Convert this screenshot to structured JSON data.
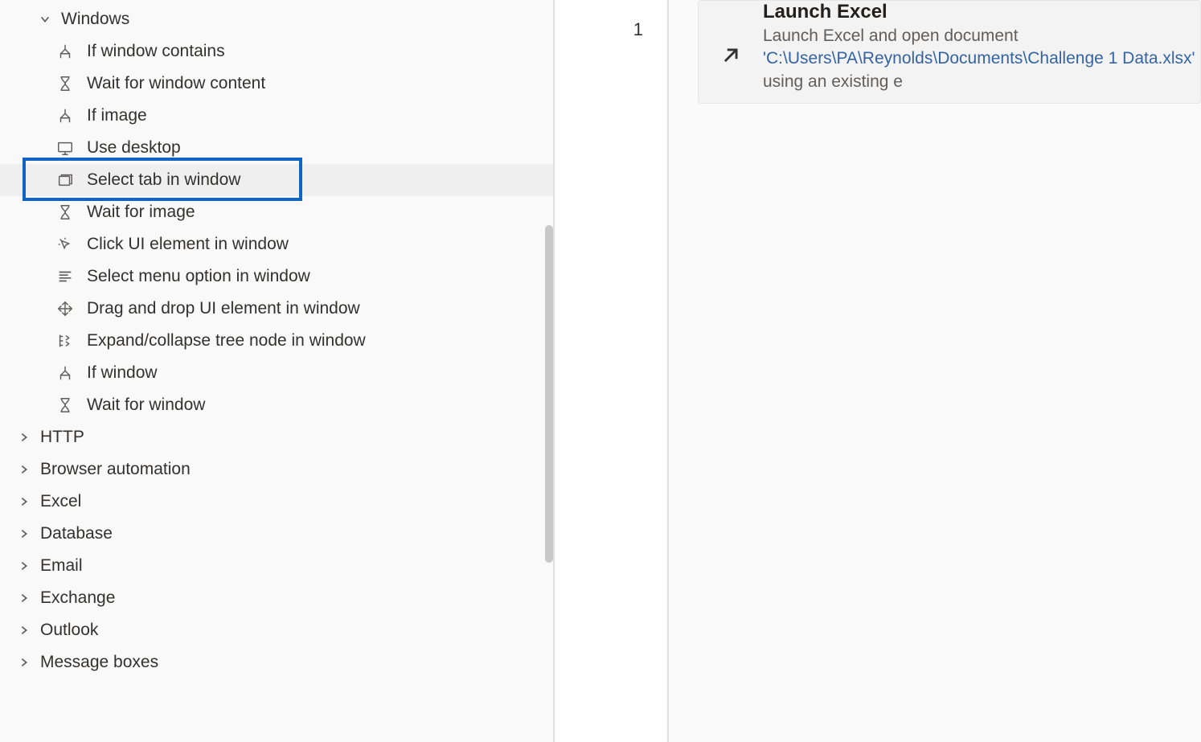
{
  "tree": {
    "expanded_category": "Windows",
    "actions": [
      {
        "label": "If window contains",
        "icon": "branch"
      },
      {
        "label": "Wait for window content",
        "icon": "hourglass"
      },
      {
        "label": "If image",
        "icon": "branch"
      },
      {
        "label": "Use desktop",
        "icon": "desktop"
      },
      {
        "label": "Select tab in window",
        "icon": "tabs",
        "highlighted": true
      },
      {
        "label": "Wait for image",
        "icon": "hourglass"
      },
      {
        "label": "Click UI element in window",
        "icon": "cursor-click"
      },
      {
        "label": "Select menu option in window",
        "icon": "menu-lines"
      },
      {
        "label": "Drag and drop UI element in window",
        "icon": "drag"
      },
      {
        "label": "Expand/collapse tree node in window",
        "icon": "tree-expand"
      },
      {
        "label": "If window",
        "icon": "branch"
      },
      {
        "label": "Wait for window",
        "icon": "hourglass"
      }
    ],
    "categories": [
      "HTTP",
      "Browser automation",
      "Excel",
      "Database",
      "Email",
      "Exchange",
      "Outlook",
      "Message boxes"
    ]
  },
  "flow": {
    "line_number": "1",
    "step_title": "Launch Excel",
    "step_sub_before": "Launch Excel and open document ",
    "step_sub_link": "'C:\\Users\\PA\\Reynolds\\Documents\\Challenge 1 Data.xlsx'",
    "step_sub_after": " using an existing e"
  }
}
